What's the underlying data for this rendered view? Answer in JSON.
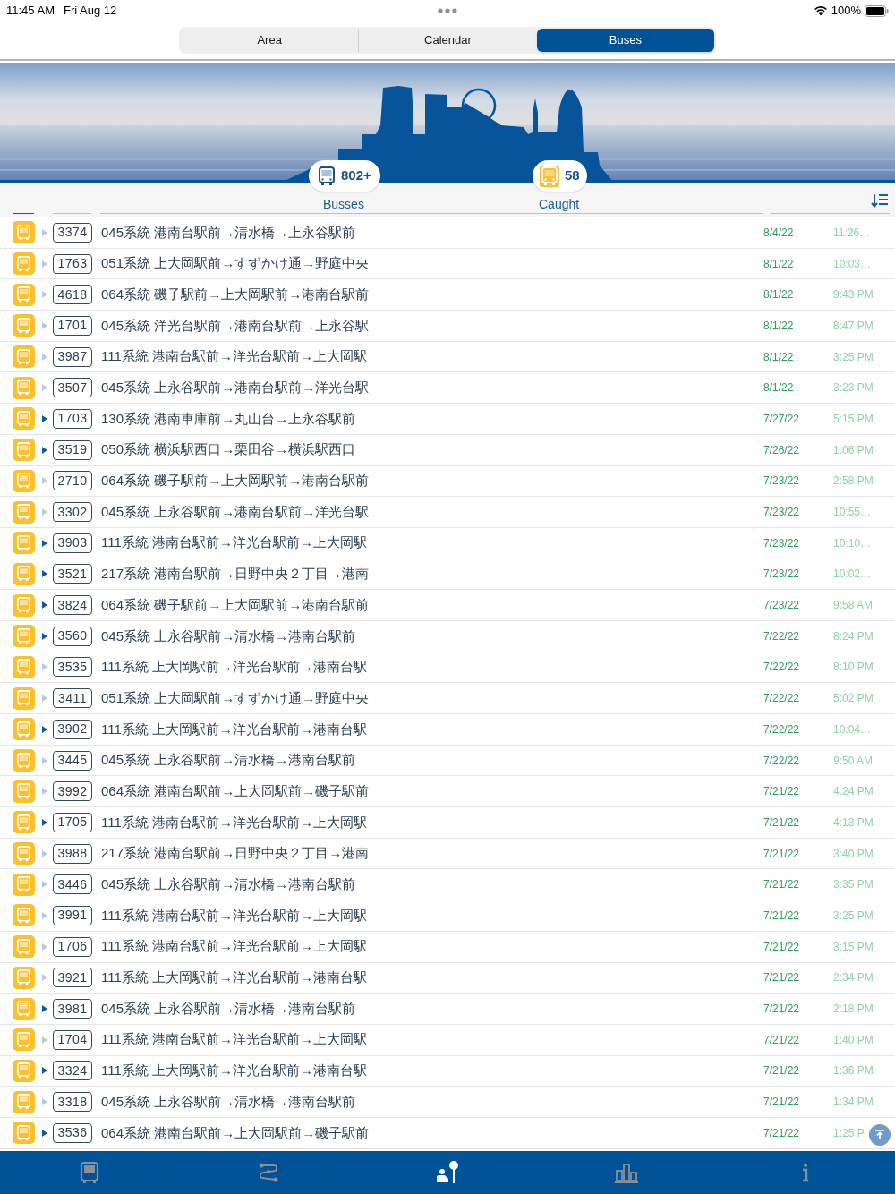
{
  "status_bar": {
    "time": "11:45 AM",
    "date": "Fri Aug 12",
    "battery": "100%"
  },
  "segments": [
    {
      "label": "Area",
      "selected": false
    },
    {
      "label": "Calendar",
      "selected": false
    },
    {
      "label": "Buses",
      "selected": true
    }
  ],
  "banner": {
    "kind": "picture",
    "busses_count": "802+",
    "caught_count": "58"
  },
  "columns": {
    "busses": "Busses",
    "caught": "Caught"
  },
  "rows": [
    {
      "number": "3374",
      "route": "045系統 港南台駅前→清水橋→上永谷駅前",
      "date": "8/4/22",
      "time": "11:26…",
      "flagged": false
    },
    {
      "number": "1763",
      "route": "051系統 上大岡駅前→すずかけ通→野庭中央",
      "date": "8/1/22",
      "time": "10:03…",
      "flagged": false
    },
    {
      "number": "4618",
      "route": "064系統 磯子駅前→上大岡駅前→港南台駅前",
      "date": "8/1/22",
      "time": "9:43 PM",
      "flagged": false
    },
    {
      "number": "1701",
      "route": "045系統 洋光台駅前→港南台駅前→上永谷駅",
      "date": "8/1/22",
      "time": "8:47 PM",
      "flagged": false
    },
    {
      "number": "3987",
      "route": "111系統 港南台駅前→洋光台駅前→上大岡駅",
      "date": "8/1/22",
      "time": "3:25 PM",
      "flagged": false
    },
    {
      "number": "3507",
      "route": "045系統 上永谷駅前→港南台駅前→洋光台駅",
      "date": "8/1/22",
      "time": "3:23 PM",
      "flagged": false
    },
    {
      "number": "1703",
      "route": "130系統 港南車庫前→丸山台→上永谷駅前",
      "date": "7/27/22",
      "time": "5:15 PM",
      "flagged": true
    },
    {
      "number": "3519",
      "route": "050系統 横浜駅西口→栗田谷→横浜駅西口",
      "date": "7/26/22",
      "time": "1:06 PM",
      "flagged": true
    },
    {
      "number": "2710",
      "route": "064系統 磯子駅前→上大岡駅前→港南台駅前",
      "date": "7/23/22",
      "time": "2:58 PM",
      "flagged": false
    },
    {
      "number": "3302",
      "route": "045系統 上永谷駅前→港南台駅前→洋光台駅",
      "date": "7/23/22",
      "time": "10:55…",
      "flagged": false
    },
    {
      "number": "3903",
      "route": "111系統 港南台駅前→洋光台駅前→上大岡駅",
      "date": "7/23/22",
      "time": "10:10…",
      "flagged": true
    },
    {
      "number": "3521",
      "route": "217系統 港南台駅前→日野中央２丁目→港南",
      "date": "7/23/22",
      "time": "10:02…",
      "flagged": true
    },
    {
      "number": "3824",
      "route": "064系統 磯子駅前→上大岡駅前→港南台駅前",
      "date": "7/23/22",
      "time": "9:58 AM",
      "flagged": true
    },
    {
      "number": "3560",
      "route": "045系統 上永谷駅前→清水橋→港南台駅前",
      "date": "7/22/22",
      "time": "8:24 PM",
      "flagged": true
    },
    {
      "number": "3535",
      "route": "111系統 上大岡駅前→洋光台駅前→港南台駅",
      "date": "7/22/22",
      "time": "8:10 PM",
      "flagged": false
    },
    {
      "number": "3411",
      "route": "051系統 上大岡駅前→すずかけ通→野庭中央",
      "date": "7/22/22",
      "time": "5:02 PM",
      "flagged": false
    },
    {
      "number": "3902",
      "route": "111系統 上大岡駅前→洋光台駅前→港南台駅",
      "date": "7/22/22",
      "time": "10:04…",
      "flagged": true
    },
    {
      "number": "3445",
      "route": "045系統 上永谷駅前→清水橋→港南台駅前",
      "date": "7/22/22",
      "time": "9:50 AM",
      "flagged": false
    },
    {
      "number": "3992",
      "route": "064系統 港南台駅前→上大岡駅前→磯子駅前",
      "date": "7/21/22",
      "time": "4:24 PM",
      "flagged": false
    },
    {
      "number": "1705",
      "route": "111系統 港南台駅前→洋光台駅前→上大岡駅",
      "date": "7/21/22",
      "time": "4:13 PM",
      "flagged": true
    },
    {
      "number": "3988",
      "route": "217系統 港南台駅前→日野中央２丁目→港南",
      "date": "7/21/22",
      "time": "3:40 PM",
      "flagged": false
    },
    {
      "number": "3446",
      "route": "045系統 上永谷駅前→清水橋→港南台駅前",
      "date": "7/21/22",
      "time": "3:35 PM",
      "flagged": false
    },
    {
      "number": "3991",
      "route": "111系統 港南台駅前→洋光台駅前→上大岡駅",
      "date": "7/21/22",
      "time": "3:25 PM",
      "flagged": false
    },
    {
      "number": "1706",
      "route": "111系統 港南台駅前→洋光台駅前→上大岡駅",
      "date": "7/21/22",
      "time": "3:15 PM",
      "flagged": false
    },
    {
      "number": "3921",
      "route": "111系統 上大岡駅前→洋光台駅前→港南台駅",
      "date": "7/21/22",
      "time": "2:34 PM",
      "flagged": false
    },
    {
      "number": "3981",
      "route": "045系統 上永谷駅前→清水橋→港南台駅前",
      "date": "7/21/22",
      "time": "2:18 PM",
      "flagged": true
    },
    {
      "number": "1704",
      "route": "111系統 港南台駅前→洋光台駅前→上大岡駅",
      "date": "7/21/22",
      "time": "1:40 PM",
      "flagged": false
    },
    {
      "number": "3324",
      "route": "111系統 上大岡駅前→洋光台駅前→港南台駅",
      "date": "7/21/22",
      "time": "1:36 PM",
      "flagged": true
    },
    {
      "number": "3318",
      "route": "045系統 上永谷駅前→清水橋→港南台駅前",
      "date": "7/21/22",
      "time": "1:34 PM",
      "flagged": false
    },
    {
      "number": "3536",
      "route": "064系統 港南台駅前→上大岡駅前→磯子駅前",
      "date": "7/21/22",
      "time": "1:25 P",
      "flagged": true
    }
  ],
  "tab_bar": [
    {
      "kind": "bus",
      "selected": false
    },
    {
      "kind": "route",
      "selected": false
    },
    {
      "kind": "stop",
      "selected": true
    },
    {
      "kind": "ranking",
      "selected": false
    },
    {
      "kind": "info",
      "selected": false
    }
  ]
}
